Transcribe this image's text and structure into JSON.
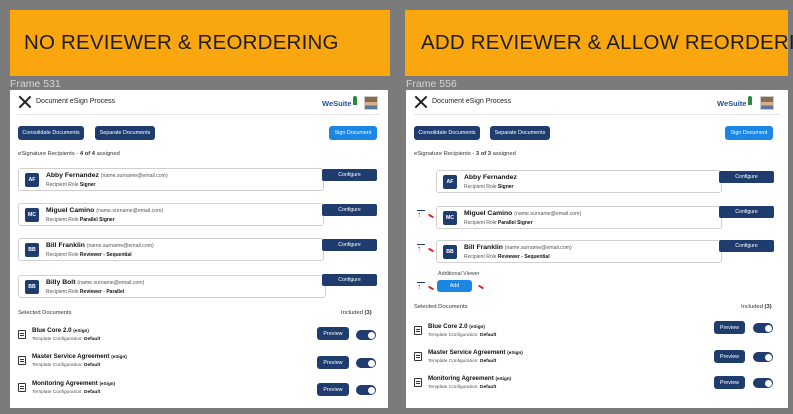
{
  "banners": {
    "left": "NO REVIEWER & REORDERING",
    "right": "ADD REVIEWER & ALLOW REORDERING"
  },
  "frames": {
    "left": {
      "label": "Frame 531",
      "title": "Document eSign Process",
      "logo": "WeSuite",
      "buttons": {
        "consolidate": "Consolidate Documents",
        "separate": "Separate Documents",
        "sign": "Sign Document"
      },
      "recipients_label": "eSignature Recipients",
      "assigned_count": "4 of 4",
      "assigned_suffix": "assigned",
      "recipients": [
        {
          "initials": "AF",
          "name": "Abby Fernandez",
          "email": "(name.surname@email.com)",
          "role_label": "Recipient Role",
          "role": "Signer",
          "configure": "Configure"
        },
        {
          "initials": "MC",
          "name": "Miguel Camino",
          "email": "(name.surname@email.com)",
          "role_label": "Recipient Role",
          "role": "Parallel Signer",
          "configure": "Configure"
        },
        {
          "initials": "BB",
          "name": "Bill Franklin",
          "email": "(name.surname@email.com)",
          "role_label": "Recipient Role",
          "role": "Reviewer - Sequential",
          "configure": "Configure"
        },
        {
          "initials": "BB",
          "name": "Billy Bolt",
          "email": "(name.surname@email.com)",
          "role_label": "Recipient Role",
          "role": "Reviewer - Parallel",
          "configure": "Configure"
        }
      ],
      "selected_label": "Selected Documents",
      "included_label": "Included",
      "included_count": "(3)",
      "documents": [
        {
          "title": "Blue Core 2.0",
          "tag": "(eSign)",
          "sub_label": "Template Configuration:",
          "sub_value": "Default",
          "preview": "Preview"
        },
        {
          "title": "Master Service Agreement",
          "tag": "(eSign)",
          "sub_label": "Template Configuration:",
          "sub_value": "Default",
          "preview": "Preview"
        },
        {
          "title": "Monitoring Agreement",
          "tag": "(eSign)",
          "sub_label": "Template Configuration:",
          "sub_value": "Default",
          "preview": "Preview"
        }
      ]
    },
    "right": {
      "label": "Frame 556",
      "title": "Document eSign Process",
      "logo": "WeSuite",
      "buttons": {
        "consolidate": "Consolidate Documents",
        "separate": "Separate Documents",
        "sign": "Sign Document"
      },
      "recipients_label": "eSignature Recipients",
      "assigned_count": "3 of 3",
      "assigned_suffix": "assigned",
      "recipients": [
        {
          "initials": "AF",
          "name": "Abby Fernandez",
          "email": "(name.surname@email.com)",
          "role_label": "Recipient Role",
          "role": "Signer",
          "configure": "Configure"
        },
        {
          "initials": "MC",
          "name": "Miguel Camino",
          "email": "(name.surname@email.com)",
          "role_label": "Recipient Role",
          "role": "Parallel Signer",
          "configure": "Configure"
        },
        {
          "initials": "BB",
          "name": "Bill Franklin",
          "email": "(name.surname@email.com)",
          "role_label": "Recipient Role",
          "role": "Reviewer - Sequential",
          "configure": "Configure"
        }
      ],
      "additional_viewer_label": "Additional Viewer",
      "add_label": "Add",
      "selected_label": "Selected Documents",
      "included_label": "Included",
      "included_count": "(3)",
      "documents": [
        {
          "title": "Blue Core 2.0",
          "tag": "(eSign)",
          "sub_label": "Template Configuration:",
          "sub_value": "Default",
          "preview": "Preview"
        },
        {
          "title": "Master Service Agreement",
          "tag": "(eSign)",
          "sub_label": "Template Configuration:",
          "sub_value": "Default",
          "preview": "Preview"
        },
        {
          "title": "Monitoring Agreement",
          "tag": "(eSign)",
          "sub_label": "Template Configuration:",
          "sub_value": "Default",
          "preview": "Preview"
        }
      ]
    }
  },
  "colors": {
    "banner": "#f9a60f",
    "navy": "#1f3c6e",
    "blue": "#1b86e4",
    "drag_marker": "#e1232e"
  }
}
